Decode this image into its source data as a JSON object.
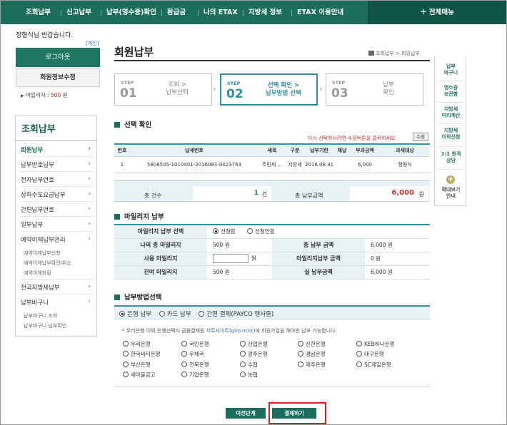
{
  "topnav": {
    "items": [
      "조회납부",
      "신고납부",
      "납부(영수증)확인",
      "환급금",
      "나의 ETAX",
      "지방세 정보",
      "ETAX 이용안내"
    ],
    "allmenu": "＋ 전체메뉴"
  },
  "user": {
    "greeting": "정형식님 반갑습니다.",
    "personal": "[개인]",
    "logout": "로그아웃",
    "edit": "회원정보수정",
    "mileage_label": "마일리지 :",
    "mileage_value": "500",
    "mileage_unit": "원"
  },
  "leftnav": {
    "title": "조회납부",
    "items": [
      "회원납부",
      "납부번호납부",
      "전자납부번호",
      "상하수도요금납부",
      "간편납부번호",
      "일부납부",
      "예약이체납부관리",
      "전국지방세납부",
      "납부바구니"
    ],
    "subs_reserve": [
      "예약이체납부신청",
      "예약이체납부확인/취소",
      "예약이체현황"
    ],
    "subs_basket": [
      "납부바구니 조회",
      "납부바구니 납부확인"
    ]
  },
  "page": {
    "title": "회원납부",
    "breadcrumb": "조회납부 > 회원납부"
  },
  "steps": [
    {
      "label": "STEP",
      "num": "01",
      "text1": "조회 >",
      "text2": "납부선택"
    },
    {
      "label": "STEP",
      "num": "02",
      "text1": "선택 확인 >",
      "text2": "납부방법 선택"
    },
    {
      "label": "STEP",
      "num": "03",
      "text1": "납부",
      "text2": "확인"
    }
  ],
  "section1": {
    "title": "선택 확인",
    "notice": "다시 선택하시려면 수정버튼을 클릭하세요.",
    "edit_btn": "수정",
    "headers": [
      "번호",
      "납세번호",
      "세목",
      "구분",
      "납부기한",
      "체납",
      "부과금액",
      "과세대상"
    ],
    "row": [
      "1",
      "5606505-1010401-2016081-0023763",
      "주민세 ...",
      "지방세",
      "2016.08.31",
      "",
      "6,000",
      "정형식"
    ]
  },
  "summary": {
    "count_label": "총 건수",
    "count_value": "1",
    "count_unit": "건",
    "amount_label": "총 납부금액",
    "amount_value": "6,000",
    "amount_unit": "원"
  },
  "section2": {
    "title": "마일리지 납부",
    "select_label": "마일리지 납부 선택",
    "opt_apply": "신청함",
    "opt_no": "신청안함",
    "my_label": "나의 총 마일리지",
    "my_value": "500 원",
    "total_label": "총 납부 금액",
    "total_value": "6,000 원",
    "use_label": "사용 마일리지",
    "use_unit": "원",
    "mpay_label": "마일리지납부 금액",
    "mpay_value": "0 원",
    "rest_label": "잔여 마일리지",
    "rest_value": "500 원",
    "real_label": "실 납부금액",
    "real_value": "6,000 원"
  },
  "section3": {
    "title": "납부방법선택",
    "methods": [
      "은행 납부",
      "카드 납부",
      "간편 결제(PAYCO 행사중)"
    ],
    "note_pre": "* 우리은행 이외 은행선택시 금융결제원 ",
    "note_link": "지로사이트(giro.or.kr)",
    "note_post": "에 회원가입을 해야만 납부 가능합니다.",
    "banks": [
      "우리은행",
      "국민은행",
      "산업은행",
      "신한은행",
      "KEB하나은행",
      "한국씨티은행",
      "우체국",
      "광주은행",
      "경남은행",
      "대구은행",
      "부산은행",
      "전북은행",
      "수협",
      "제주은행",
      "SC제일은행",
      "새마을금고",
      "기업은행",
      "농협"
    ]
  },
  "buttons": {
    "prev": "이전단계",
    "pay": "결제하기"
  },
  "quick": [
    "납부",
    "바구니",
    "영수증",
    "보관함",
    "지방세",
    "미리계산",
    "지방세",
    "이의신청",
    "1:1 원격",
    "상담",
    "확대보기",
    "안내"
  ],
  "colors": {
    "brand": "#1b6e5c",
    "accent": "#2e8fa1",
    "alert": "#d2322d"
  }
}
